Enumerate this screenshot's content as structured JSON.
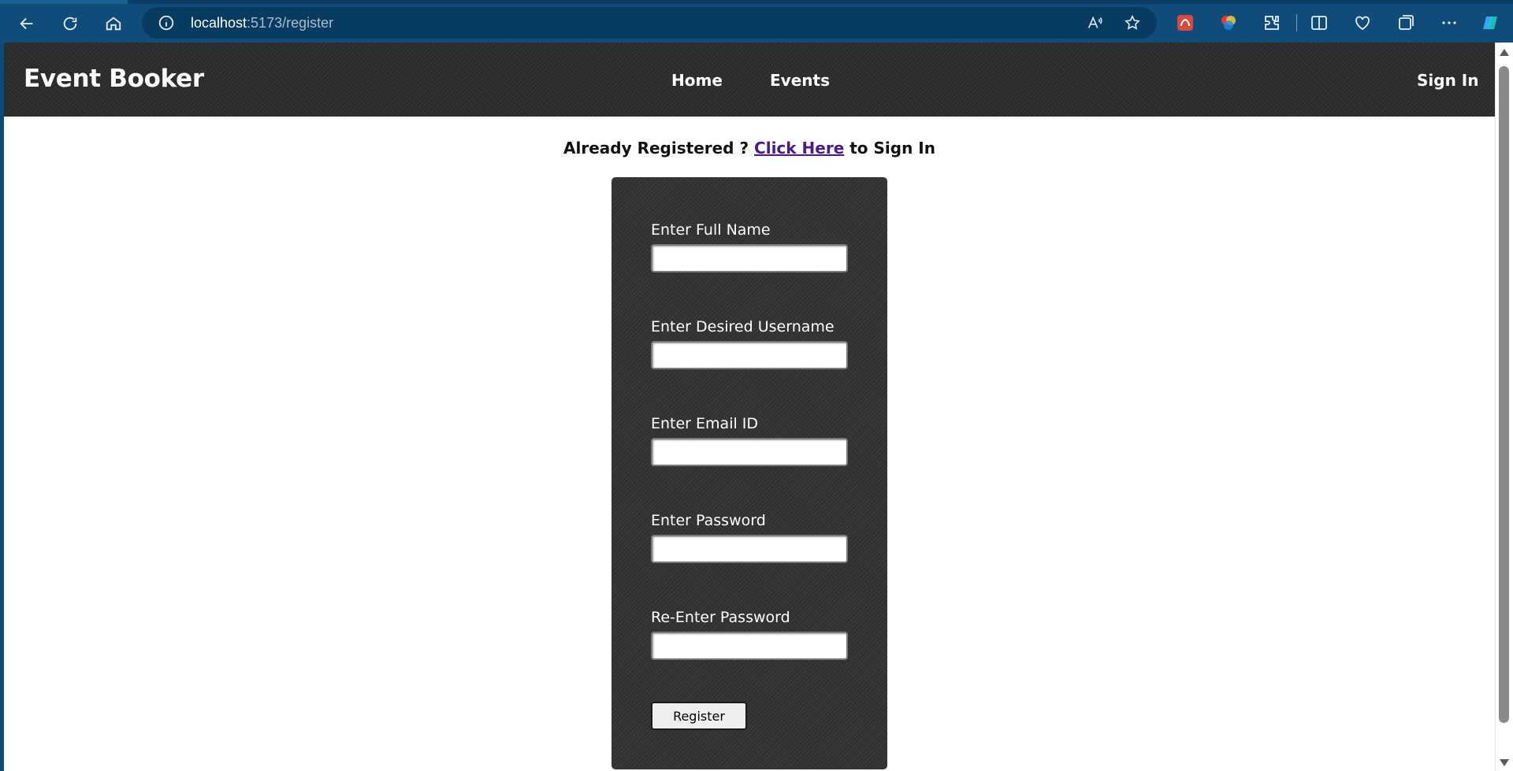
{
  "browser": {
    "url_host": "localhost",
    "url_path": ":5173/register"
  },
  "app": {
    "brand": "Event Booker",
    "nav": {
      "home": "Home",
      "events": "Events",
      "sign_in": "Sign In"
    }
  },
  "register_page": {
    "prompt_prefix": "Already Registered ? ",
    "prompt_link": "Click Here",
    "prompt_suffix": " to Sign In",
    "fields": {
      "full_name": {
        "label": "Enter Full Name",
        "value": ""
      },
      "username": {
        "label": "Enter Desired Username",
        "value": ""
      },
      "email": {
        "label": "Enter Email ID",
        "value": ""
      },
      "password": {
        "label": "Enter Password",
        "value": ""
      },
      "confirm_password": {
        "label": "Re-Enter Password",
        "value": ""
      }
    },
    "submit_label": "Register"
  }
}
